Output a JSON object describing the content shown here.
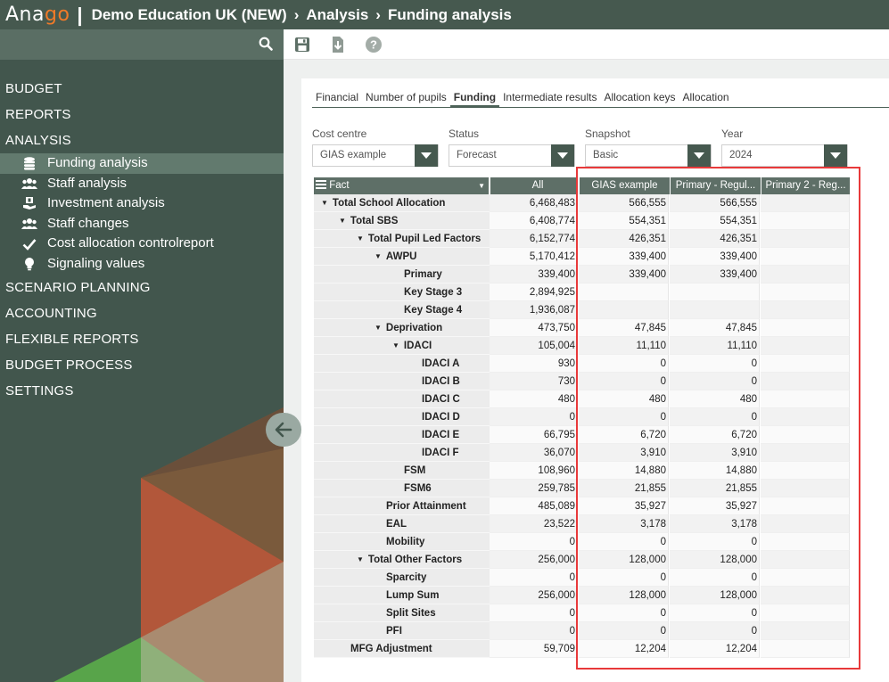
{
  "app": {
    "logo": "Anago",
    "breadcrumb": [
      "Demo Education UK (NEW)",
      "Analysis",
      "Funding analysis"
    ]
  },
  "sidebar": {
    "items": [
      {
        "label": "BUDGET"
      },
      {
        "label": "REPORTS"
      },
      {
        "label": "ANALYSIS"
      }
    ],
    "analysis_items": [
      {
        "label": "Funding analysis",
        "icon": "coins-icon"
      },
      {
        "label": "Staff analysis",
        "icon": "people-icon"
      },
      {
        "label": "Investment analysis",
        "icon": "hand-money-icon"
      },
      {
        "label": "Staff changes",
        "icon": "people-icon"
      },
      {
        "label": "Cost allocation controlreport",
        "icon": "check-icon"
      },
      {
        "label": "Signaling values",
        "icon": "bulb-icon"
      }
    ],
    "items_after": [
      {
        "label": "SCENARIO PLANNING"
      },
      {
        "label": "ACCOUNTING"
      },
      {
        "label": "FLEXIBLE REPORTS"
      },
      {
        "label": "BUDGET PROCESS"
      },
      {
        "label": "SETTINGS"
      }
    ]
  },
  "tabs": [
    "Financial",
    "Number of pupils",
    "Funding",
    "Intermediate results",
    "Allocation keys",
    "Allocation"
  ],
  "filters": {
    "cost_centre": {
      "label": "Cost centre",
      "value": "GIAS example"
    },
    "status": {
      "label": "Status",
      "value": "Forecast"
    },
    "snapshot": {
      "label": "Snapshot",
      "value": "Basic"
    },
    "year": {
      "label": "Year",
      "value": "2024"
    }
  },
  "pivot": {
    "fact_header": "Fact",
    "columns": [
      "All",
      "GIAS example",
      "Primary - Regul...",
      "Primary 2 - Reg..."
    ],
    "rows": [
      {
        "label": "Total School Allocation",
        "level": 0,
        "caret": true,
        "values": [
          "6,468,483",
          "566,555",
          "566,555",
          ""
        ]
      },
      {
        "label": "Total SBS",
        "level": 1,
        "caret": true,
        "values": [
          "6,408,774",
          "554,351",
          "554,351",
          ""
        ]
      },
      {
        "label": "Total Pupil Led Factors",
        "level": 2,
        "caret": true,
        "values": [
          "6,152,774",
          "426,351",
          "426,351",
          ""
        ]
      },
      {
        "label": "AWPU",
        "level": 3,
        "caret": true,
        "values": [
          "5,170,412",
          "339,400",
          "339,400",
          ""
        ]
      },
      {
        "label": "Primary",
        "level": 4,
        "caret": false,
        "values": [
          "339,400",
          "339,400",
          "339,400",
          ""
        ]
      },
      {
        "label": "Key Stage 3",
        "level": 4,
        "caret": false,
        "values": [
          "2,894,925",
          "",
          "",
          ""
        ]
      },
      {
        "label": "Key Stage 4",
        "level": 4,
        "caret": false,
        "values": [
          "1,936,087",
          "",
          "",
          ""
        ]
      },
      {
        "label": "Deprivation",
        "level": 3,
        "caret": true,
        "values": [
          "473,750",
          "47,845",
          "47,845",
          ""
        ]
      },
      {
        "label": "IDACI",
        "level": 4,
        "caret": true,
        "values": [
          "105,004",
          "11,110",
          "11,110",
          ""
        ]
      },
      {
        "label": "IDACI A",
        "level": 5,
        "caret": false,
        "values": [
          "930",
          "0",
          "0",
          ""
        ]
      },
      {
        "label": "IDACI B",
        "level": 5,
        "caret": false,
        "values": [
          "730",
          "0",
          "0",
          ""
        ]
      },
      {
        "label": "IDACI C",
        "level": 5,
        "caret": false,
        "values": [
          "480",
          "480",
          "480",
          ""
        ]
      },
      {
        "label": "IDACI D",
        "level": 5,
        "caret": false,
        "values": [
          "0",
          "0",
          "0",
          ""
        ]
      },
      {
        "label": "IDACI E",
        "level": 5,
        "caret": false,
        "values": [
          "66,795",
          "6,720",
          "6,720",
          ""
        ]
      },
      {
        "label": "IDACI F",
        "level": 5,
        "caret": false,
        "values": [
          "36,070",
          "3,910",
          "3,910",
          ""
        ]
      },
      {
        "label": "FSM",
        "level": 4,
        "caret": false,
        "values": [
          "108,960",
          "14,880",
          "14,880",
          ""
        ]
      },
      {
        "label": "FSM6",
        "level": 4,
        "caret": false,
        "values": [
          "259,785",
          "21,855",
          "21,855",
          ""
        ]
      },
      {
        "label": "Prior Attainment",
        "level": 3,
        "caret": false,
        "values": [
          "485,089",
          "35,927",
          "35,927",
          ""
        ]
      },
      {
        "label": "EAL",
        "level": 3,
        "caret": false,
        "values": [
          "23,522",
          "3,178",
          "3,178",
          ""
        ]
      },
      {
        "label": "Mobility",
        "level": 3,
        "caret": false,
        "values": [
          "0",
          "0",
          "0",
          ""
        ]
      },
      {
        "label": "Total Other Factors",
        "level": 2,
        "caret": true,
        "values": [
          "256,000",
          "128,000",
          "128,000",
          ""
        ]
      },
      {
        "label": "Sparcity",
        "level": 3,
        "caret": false,
        "values": [
          "0",
          "0",
          "0",
          ""
        ]
      },
      {
        "label": "Lump Sum",
        "level": 3,
        "caret": false,
        "values": [
          "256,000",
          "128,000",
          "128,000",
          ""
        ]
      },
      {
        "label": "Split Sites",
        "level": 3,
        "caret": false,
        "values": [
          "0",
          "0",
          "0",
          ""
        ]
      },
      {
        "label": "PFI",
        "level": 3,
        "caret": false,
        "values": [
          "0",
          "0",
          "0",
          ""
        ]
      },
      {
        "label": "MFG Adjustment",
        "level": 1,
        "caret": false,
        "values": [
          "59,709",
          "12,204",
          "12,204",
          ""
        ]
      }
    ]
  },
  "colors": {
    "brand_dark": "#46594f",
    "accent_orange": "#f07a28",
    "highlight_red": "#e8393a"
  }
}
